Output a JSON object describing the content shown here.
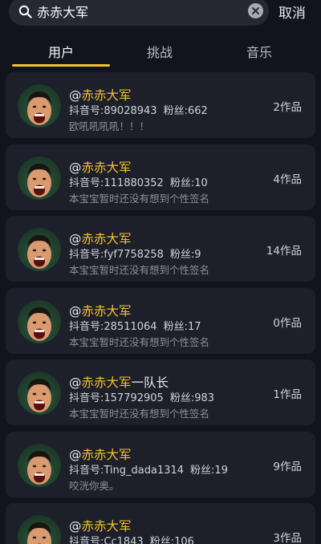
{
  "search": {
    "query": "赤赤大军",
    "cancel_label": "取消"
  },
  "tabs": [
    {
      "label": "用户",
      "active": true
    },
    {
      "label": "挑战",
      "active": false
    },
    {
      "label": "音乐",
      "active": false
    }
  ],
  "colors": {
    "accent": "#f5c22e",
    "background": "#12131c",
    "card": "#1d1f2a"
  },
  "users": [
    {
      "name_prefix": "@",
      "name_highlight": "赤赤大军",
      "name_suffix": "",
      "id_label": "抖音号:89028943",
      "fans_label": "粉丝:662",
      "signature": "欧吼吼吼吼！！！",
      "works": "2作品"
    },
    {
      "name_prefix": "@",
      "name_highlight": "赤赤大军",
      "name_suffix": "",
      "id_label": "抖音号:111880352",
      "fans_label": "粉丝:10",
      "signature": "本宝宝暂时还没有想到个性签名",
      "works": "4作品"
    },
    {
      "name_prefix": "@",
      "name_highlight": "赤赤大军",
      "name_suffix": "",
      "id_label": "抖音号:fyf7758258",
      "fans_label": "粉丝:9",
      "signature": "本宝宝暂时还没有想到个性签名",
      "works": "14作品"
    },
    {
      "name_prefix": "@",
      "name_highlight": "赤赤大军",
      "name_suffix": "",
      "id_label": "抖音号:28511064",
      "fans_label": "粉丝:17",
      "signature": "本宝宝暂时还没有想到个性签名",
      "works": "0作品"
    },
    {
      "name_prefix": "@",
      "name_highlight": "赤赤大军",
      "name_suffix": "一队长",
      "id_label": "抖音号:157792905",
      "fans_label": "粉丝:983",
      "signature": "本宝宝暂时还没有想到个性签名",
      "works": "1作品"
    },
    {
      "name_prefix": "@",
      "name_highlight": "赤赤大军",
      "name_suffix": "",
      "id_label": "抖音号:Ting_dada1314",
      "fans_label": "粉丝:19",
      "signature": "咬洸你奥。",
      "works": "9作品"
    },
    {
      "name_prefix": "@",
      "name_highlight": "赤赤大军",
      "name_suffix": "",
      "id_label": "抖音号:Cc1843",
      "fans_label": "粉丝:106",
      "signature": "",
      "works": "3作品"
    }
  ]
}
